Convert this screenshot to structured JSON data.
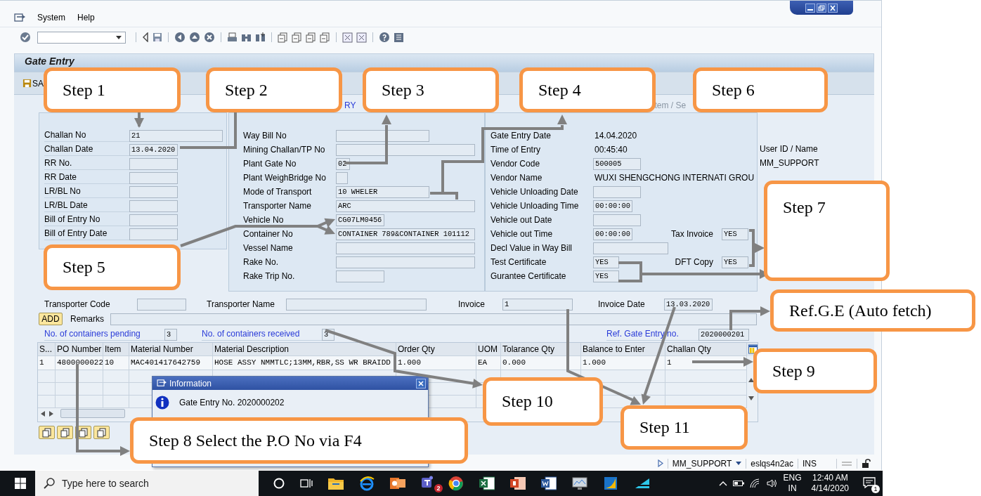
{
  "menu": [
    {
      "label": "System"
    },
    {
      "label": "Help"
    }
  ],
  "screen_title": "Gate Entry",
  "save_button": "SA",
  "group_titles": [
    {
      "text": "RY",
      "kind": "link"
    },
    {
      "text": "tem / Se",
      "kind": "muted"
    }
  ],
  "challan_group": [
    {
      "label": "Challan No",
      "value": "21"
    },
    {
      "label": "Challan Date",
      "value": "13.04.2020"
    },
    {
      "label": "RR No."
    },
    {
      "label": "RR Date"
    },
    {
      "label": "LR/BL No"
    },
    {
      "label": "LR/BL Date"
    },
    {
      "label": "Bill of Entry No"
    },
    {
      "label": "Bill of Entry Date"
    }
  ],
  "transport_group": [
    {
      "label": "Way Bill No"
    },
    {
      "label": "Mining Challan/TP No"
    },
    {
      "label": "Plant Gate No",
      "value": "02"
    },
    {
      "label": "Plant WeighBridge No"
    },
    {
      "label": "Mode of Transport",
      "value": "10 WHELER"
    },
    {
      "label": "Transporter Name",
      "value": "ARC"
    },
    {
      "label": "Vehicle No",
      "value": "CG07LM0456"
    },
    {
      "label": "Container No",
      "value": "CONTAINER 789&CONTAINER 101112"
    },
    {
      "label": "Vessel Name"
    },
    {
      "label": "Rake No."
    },
    {
      "label": "Rake Trip No."
    }
  ],
  "entry_group": [
    {
      "label": "Gate Entry Date",
      "value": "14.04.2020",
      "kind": "text"
    },
    {
      "label": "Time of Entry",
      "value": "00:45:40",
      "kind": "text"
    },
    {
      "label": "Vendor Code",
      "value": "500005",
      "kind": "field"
    },
    {
      "label": "Vendor Name",
      "value": "WUXI SHENGCHONG INTERNATI GROU",
      "kind": "text"
    },
    {
      "label": "Vehicle Unloading Date",
      "kind": "field"
    },
    {
      "label": "Vehicle Unloading Time",
      "value": "00:00:00",
      "kind": "field"
    },
    {
      "label": "Vehicle out Date",
      "kind": "field"
    },
    {
      "label": "Vehicle out Time",
      "value": "00:00:00",
      "kind": "field",
      "extra": {
        "label": "Tax Invoice",
        "value": "YES"
      }
    },
    {
      "label": "Decl Value in Way Bill",
      "kind": "field"
    },
    {
      "label": "Test Certificate",
      "value": "YES",
      "kind": "field",
      "extra": {
        "label": "DFT Copy",
        "value": "YES"
      }
    },
    {
      "label": "Gurantee Certificate",
      "value": "YES",
      "kind": "field"
    }
  ],
  "user": {
    "label": "User ID / Name",
    "value": "MM_SUPPORT"
  },
  "transporter_row": [
    {
      "label": "Transporter Code"
    },
    {
      "label": "Transporter Name"
    },
    {
      "label": "Invoice",
      "value": "1"
    },
    {
      "label": "Invoice Date",
      "value": "13.03.2020"
    }
  ],
  "add_button": "ADD",
  "remarks": {
    "label": "Remarks"
  },
  "counters": [
    {
      "label": "No. of containers pending",
      "value": "3"
    },
    {
      "label": "No. of containers received",
      "value": "3"
    },
    {
      "label": "Ref. Gate Entry no.",
      "value": "2020000201"
    }
  ],
  "table": {
    "columns": [
      "S...",
      "PO Number",
      "Item",
      "Material Number",
      "Material Description",
      "Order Qty",
      "UOM",
      "Tolarance Qty",
      "Balance to Enter",
      "Challan Qty"
    ],
    "rows": [
      [
        "1",
        "4800000022",
        "10",
        "MAC401417642759",
        "HOSE ASSY NMMTLC;13MM,RBR,SS WR BRAIDD",
        "1.000",
        "EA",
        "0.000",
        "1.000",
        "1"
      ]
    ]
  },
  "dialog": {
    "title": "Information",
    "message": "Gate Entry No. 2020000202"
  },
  "status_bar": {
    "user": "MM_SUPPORT",
    "server": "eslqs4n2ac",
    "mode": "INS"
  },
  "taskbar": {
    "search_placeholder": "Type here to search",
    "teams_badge": "2",
    "language": "ENG",
    "region": "IN",
    "time": "12:40 AM",
    "date": "4/14/2020",
    "notifications": "1"
  },
  "callouts": [
    {
      "text": "Step 1"
    },
    {
      "text": "Step 2"
    },
    {
      "text": "Step 3"
    },
    {
      "text": "Step 4"
    },
    {
      "text": "Step 6"
    },
    {
      "text": "Step 7"
    },
    {
      "text": "Step 5"
    },
    {
      "text": "Ref.G.E (Auto fetch)"
    },
    {
      "text": "Step 9"
    },
    {
      "text": "Step 10"
    },
    {
      "text": "Step 11"
    },
    {
      "text": "Step 8 Select the P.O No via F4"
    }
  ]
}
